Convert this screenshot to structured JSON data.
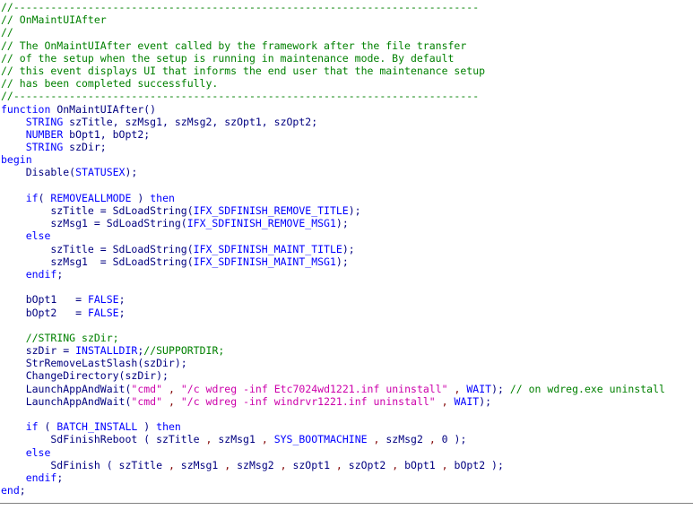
{
  "editor": {
    "language": "InstallScript",
    "colors": {
      "background": "#ffffff",
      "comment": "#008000",
      "keyword": "#0000ff",
      "constant": "#0000ff",
      "identifier": "#000080",
      "string": "#cc00aa",
      "punctuation": "#800000"
    }
  },
  "code": {
    "lines": [
      [
        {
          "t": "comment",
          "s": "//---------------------------------------------------------------------------"
        }
      ],
      [
        {
          "t": "comment",
          "s": "// OnMaintUIAfter"
        }
      ],
      [
        {
          "t": "comment",
          "s": "//"
        }
      ],
      [
        {
          "t": "comment",
          "s": "// The OnMaintUIAfter event called by the framework after the file transfer"
        }
      ],
      [
        {
          "t": "comment",
          "s": "// of the setup when the setup is running in maintenance mode. By default"
        }
      ],
      [
        {
          "t": "comment",
          "s": "// this event displays UI that informs the end user that the maintenance setup"
        }
      ],
      [
        {
          "t": "comment",
          "s": "// has been completed successfully."
        }
      ],
      [
        {
          "t": "comment",
          "s": "//---------------------------------------------------------------------------"
        }
      ],
      [
        {
          "t": "keyword",
          "s": "function"
        },
        {
          "t": "plain",
          "s": " OnMaintUIAfter()"
        }
      ],
      [
        {
          "t": "plain",
          "s": "    "
        },
        {
          "t": "keyword",
          "s": "STRING"
        },
        {
          "t": "plain",
          "s": " szTitle, szMsg1, szMsg2, szOpt1, szOpt2;"
        }
      ],
      [
        {
          "t": "plain",
          "s": "    "
        },
        {
          "t": "keyword",
          "s": "NUMBER"
        },
        {
          "t": "plain",
          "s": " bOpt1, bOpt2;"
        }
      ],
      [
        {
          "t": "plain",
          "s": "    "
        },
        {
          "t": "keyword",
          "s": "STRING"
        },
        {
          "t": "plain",
          "s": " szDir;"
        }
      ],
      [
        {
          "t": "keyword",
          "s": "begin"
        }
      ],
      [
        {
          "t": "plain",
          "s": "    Disable("
        },
        {
          "t": "const",
          "s": "STATUSEX"
        },
        {
          "t": "plain",
          "s": ");"
        }
      ],
      [
        {
          "t": "plain",
          "s": ""
        }
      ],
      [
        {
          "t": "plain",
          "s": "    "
        },
        {
          "t": "keyword",
          "s": "if"
        },
        {
          "t": "plain",
          "s": "( "
        },
        {
          "t": "const",
          "s": "REMOVEALLMODE"
        },
        {
          "t": "plain",
          "s": " ) "
        },
        {
          "t": "keyword",
          "s": "then"
        }
      ],
      [
        {
          "t": "plain",
          "s": "        szTitle = SdLoadString("
        },
        {
          "t": "const",
          "s": "IFX_SDFINISH_REMOVE_TITLE"
        },
        {
          "t": "plain",
          "s": ");"
        }
      ],
      [
        {
          "t": "plain",
          "s": "        szMsg1 = SdLoadString("
        },
        {
          "t": "const",
          "s": "IFX_SDFINISH_REMOVE_MSG1"
        },
        {
          "t": "plain",
          "s": ");"
        }
      ],
      [
        {
          "t": "plain",
          "s": "    "
        },
        {
          "t": "keyword",
          "s": "else"
        }
      ],
      [
        {
          "t": "plain",
          "s": "        szTitle = SdLoadString("
        },
        {
          "t": "const",
          "s": "IFX_SDFINISH_MAINT_TITLE"
        },
        {
          "t": "plain",
          "s": ");"
        }
      ],
      [
        {
          "t": "plain",
          "s": "        szMsg1  = SdLoadString("
        },
        {
          "t": "const",
          "s": "IFX_SDFINISH_MAINT_MSG1"
        },
        {
          "t": "plain",
          "s": ");"
        }
      ],
      [
        {
          "t": "plain",
          "s": "    "
        },
        {
          "t": "keyword",
          "s": "endif"
        },
        {
          "t": "plain",
          "s": ";"
        }
      ],
      [
        {
          "t": "plain",
          "s": ""
        }
      ],
      [
        {
          "t": "plain",
          "s": "    bOpt1   = "
        },
        {
          "t": "const",
          "s": "FALSE"
        },
        {
          "t": "plain",
          "s": ";"
        }
      ],
      [
        {
          "t": "plain",
          "s": "    bOpt2   = "
        },
        {
          "t": "const",
          "s": "FALSE"
        },
        {
          "t": "plain",
          "s": ";"
        }
      ],
      [
        {
          "t": "plain",
          "s": ""
        }
      ],
      [
        {
          "t": "plain",
          "s": "    "
        },
        {
          "t": "comment",
          "s": "//STRING szDir;"
        }
      ],
      [
        {
          "t": "plain",
          "s": "    szDir = "
        },
        {
          "t": "const",
          "s": "INSTALLDIR"
        },
        {
          "t": "plain",
          "s": ";"
        },
        {
          "t": "comment",
          "s": "//SUPPORTDIR;"
        }
      ],
      [
        {
          "t": "plain",
          "s": "    StrRemoveLastSlash(szDir);"
        }
      ],
      [
        {
          "t": "plain",
          "s": "    ChangeDirectory(szDir);"
        }
      ],
      [
        {
          "t": "plain",
          "s": "    LaunchAppAndWait("
        },
        {
          "t": "string",
          "s": "\"cmd\""
        },
        {
          "t": "plain",
          "s": " "
        },
        {
          "t": "punct",
          "s": ","
        },
        {
          "t": "plain",
          "s": " "
        },
        {
          "t": "string",
          "s": "\"/c wdreg -inf Etc7024wd1221.inf uninstall\""
        },
        {
          "t": "plain",
          "s": " "
        },
        {
          "t": "punct",
          "s": ","
        },
        {
          "t": "plain",
          "s": " "
        },
        {
          "t": "const",
          "s": "WAIT"
        },
        {
          "t": "plain",
          "s": "); "
        },
        {
          "t": "comment",
          "s": "// on wdreg.exe uninstall"
        }
      ],
      [
        {
          "t": "plain",
          "s": "    LaunchAppAndWait("
        },
        {
          "t": "string",
          "s": "\"cmd\""
        },
        {
          "t": "plain",
          "s": " "
        },
        {
          "t": "punct",
          "s": ","
        },
        {
          "t": "plain",
          "s": " "
        },
        {
          "t": "string",
          "s": "\"/c wdreg -inf windrvr1221.inf uninstall\""
        },
        {
          "t": "plain",
          "s": " "
        },
        {
          "t": "punct",
          "s": ","
        },
        {
          "t": "plain",
          "s": " "
        },
        {
          "t": "const",
          "s": "WAIT"
        },
        {
          "t": "plain",
          "s": ");"
        }
      ],
      [
        {
          "t": "plain",
          "s": ""
        }
      ],
      [
        {
          "t": "plain",
          "s": "    "
        },
        {
          "t": "keyword",
          "s": "if"
        },
        {
          "t": "plain",
          "s": " ( "
        },
        {
          "t": "const",
          "s": "BATCH_INSTALL"
        },
        {
          "t": "plain",
          "s": " ) "
        },
        {
          "t": "keyword",
          "s": "then"
        }
      ],
      [
        {
          "t": "plain",
          "s": "        SdFinishReboot ( szTitle "
        },
        {
          "t": "punct",
          "s": ","
        },
        {
          "t": "plain",
          "s": " szMsg1 "
        },
        {
          "t": "punct",
          "s": ","
        },
        {
          "t": "plain",
          "s": " "
        },
        {
          "t": "const",
          "s": "SYS_BOOTMACHINE"
        },
        {
          "t": "plain",
          "s": " "
        },
        {
          "t": "punct",
          "s": ","
        },
        {
          "t": "plain",
          "s": " szMsg2 "
        },
        {
          "t": "punct",
          "s": ","
        },
        {
          "t": "plain",
          "s": " 0 );"
        }
      ],
      [
        {
          "t": "plain",
          "s": "    "
        },
        {
          "t": "keyword",
          "s": "else"
        }
      ],
      [
        {
          "t": "plain",
          "s": "        SdFinish ( szTitle "
        },
        {
          "t": "punct",
          "s": ","
        },
        {
          "t": "plain",
          "s": " szMsg1 "
        },
        {
          "t": "punct",
          "s": ","
        },
        {
          "t": "plain",
          "s": " szMsg2 "
        },
        {
          "t": "punct",
          "s": ","
        },
        {
          "t": "plain",
          "s": " szOpt1 "
        },
        {
          "t": "punct",
          "s": ","
        },
        {
          "t": "plain",
          "s": " szOpt2 "
        },
        {
          "t": "punct",
          "s": ","
        },
        {
          "t": "plain",
          "s": " bOpt1 "
        },
        {
          "t": "punct",
          "s": ","
        },
        {
          "t": "plain",
          "s": " bOpt2 );"
        }
      ],
      [
        {
          "t": "plain",
          "s": "    "
        },
        {
          "t": "keyword",
          "s": "endif"
        },
        {
          "t": "plain",
          "s": ";"
        }
      ],
      [
        {
          "t": "keyword",
          "s": "end"
        },
        {
          "t": "plain",
          "s": ";"
        }
      ]
    ]
  }
}
